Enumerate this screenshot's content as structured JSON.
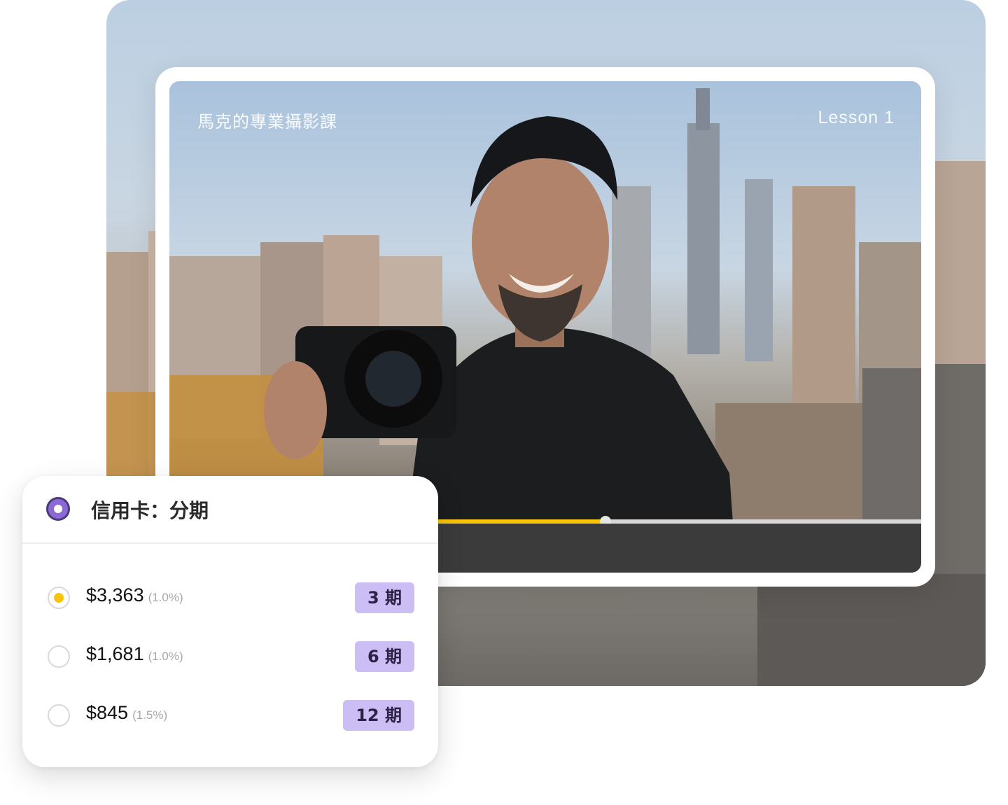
{
  "player": {
    "title": "馬克的專業攝影課",
    "lesson": "Lesson 1",
    "progress": 0.58
  },
  "payment": {
    "method_label": "信用卡：分期",
    "options": [
      {
        "amount": "$3,363",
        "rate": "(1.0%)",
        "term": "3 期",
        "selected": true
      },
      {
        "amount": "$1,681",
        "rate": "(1.0%)",
        "term": "6 期",
        "selected": false
      },
      {
        "amount": "$845",
        "rate": "(1.5%)",
        "term": "12 期",
        "selected": false
      }
    ]
  },
  "colors": {
    "accent_progress": "#f7c40a",
    "badge_bg": "#cdbdf5",
    "method_radio": "#8b6ad8"
  }
}
